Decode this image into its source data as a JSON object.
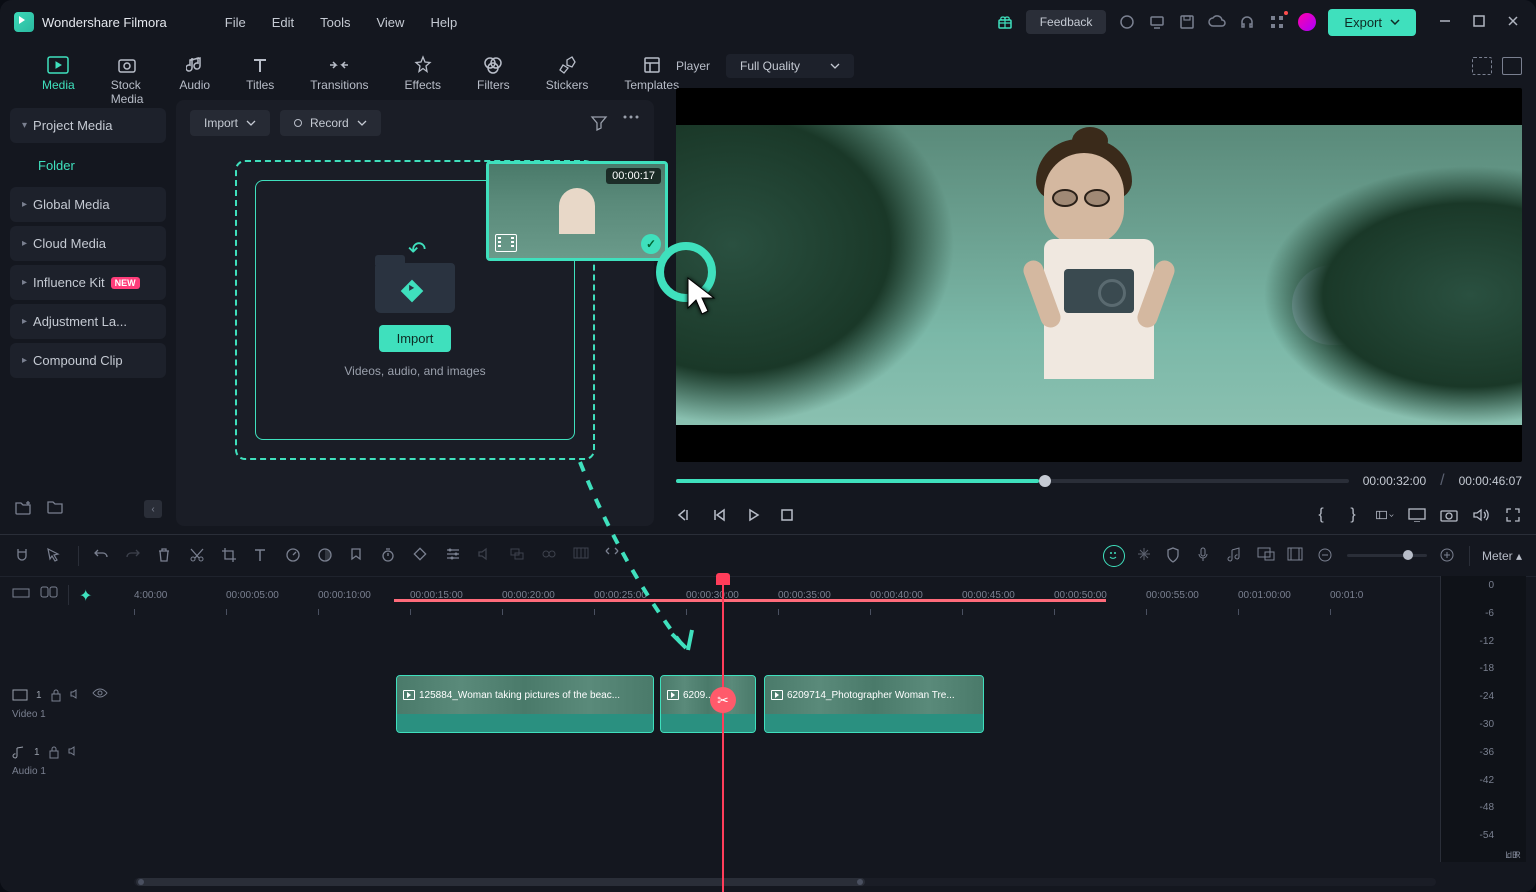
{
  "app": {
    "name": "Wondershare Filmora"
  },
  "menu": [
    "File",
    "Edit",
    "Tools",
    "View",
    "Help"
  ],
  "titlebar": {
    "feedback": "Feedback",
    "export": "Export"
  },
  "libTabs": [
    {
      "id": "media",
      "label": "Media",
      "active": true
    },
    {
      "id": "stock",
      "label": "Stock Media"
    },
    {
      "id": "audio",
      "label": "Audio"
    },
    {
      "id": "titles",
      "label": "Titles"
    },
    {
      "id": "transitions",
      "label": "Transitions"
    },
    {
      "id": "effects",
      "label": "Effects"
    },
    {
      "id": "filters",
      "label": "Filters"
    },
    {
      "id": "stickers",
      "label": "Stickers"
    },
    {
      "id": "templates",
      "label": "Templates"
    }
  ],
  "sidebar": {
    "items": [
      {
        "label": "Project Media",
        "expandable": true
      },
      {
        "label": "Folder",
        "sub": true
      },
      {
        "label": "Global Media",
        "expandable": true
      },
      {
        "label": "Cloud Media",
        "expandable": true
      },
      {
        "label": "Influence Kit",
        "expandable": true,
        "badge": "NEW"
      },
      {
        "label": "Adjustment La...",
        "expandable": true
      },
      {
        "label": "Compound Clip",
        "expandable": true
      }
    ]
  },
  "mediaToolbar": {
    "import": "Import",
    "record": "Record"
  },
  "dropZone": {
    "importBtn": "Import",
    "hint": "Videos, audio, and images"
  },
  "dragThumb": {
    "duration": "00:00:17"
  },
  "player": {
    "label": "Player",
    "quality": "Full Quality",
    "current": "00:00:32:00",
    "total": "00:00:46:07"
  },
  "ruler": {
    "ticks": [
      "4:00:00",
      "00:00:05:00",
      "00:00:10:00",
      "00:00:15:00",
      "00:00:20:00",
      "00:00:25:00",
      "00:00:30:00",
      "00:00:35:00",
      "00:00:40:00",
      "00:00:45:00",
      "00:00:50:00",
      "00:00:55:00",
      "00:01:00:00",
      "00:01:0"
    ]
  },
  "tracks": {
    "video": {
      "label": "Video 1"
    },
    "audio": {
      "label": "Audio 1"
    }
  },
  "clips": [
    {
      "name": "125884_Woman taking pictures of the beac..."
    },
    {
      "name": "6209... Pt..."
    },
    {
      "name": "6209714_Photographer Woman Tre..."
    }
  ],
  "meter": {
    "label": "Meter",
    "db": "dB",
    "scale": [
      "0",
      "-6",
      "-12",
      "-18",
      "-24",
      "-30",
      "-36",
      "-42",
      "-48",
      "-54",
      ""
    ],
    "lr": [
      "L",
      "R"
    ]
  }
}
